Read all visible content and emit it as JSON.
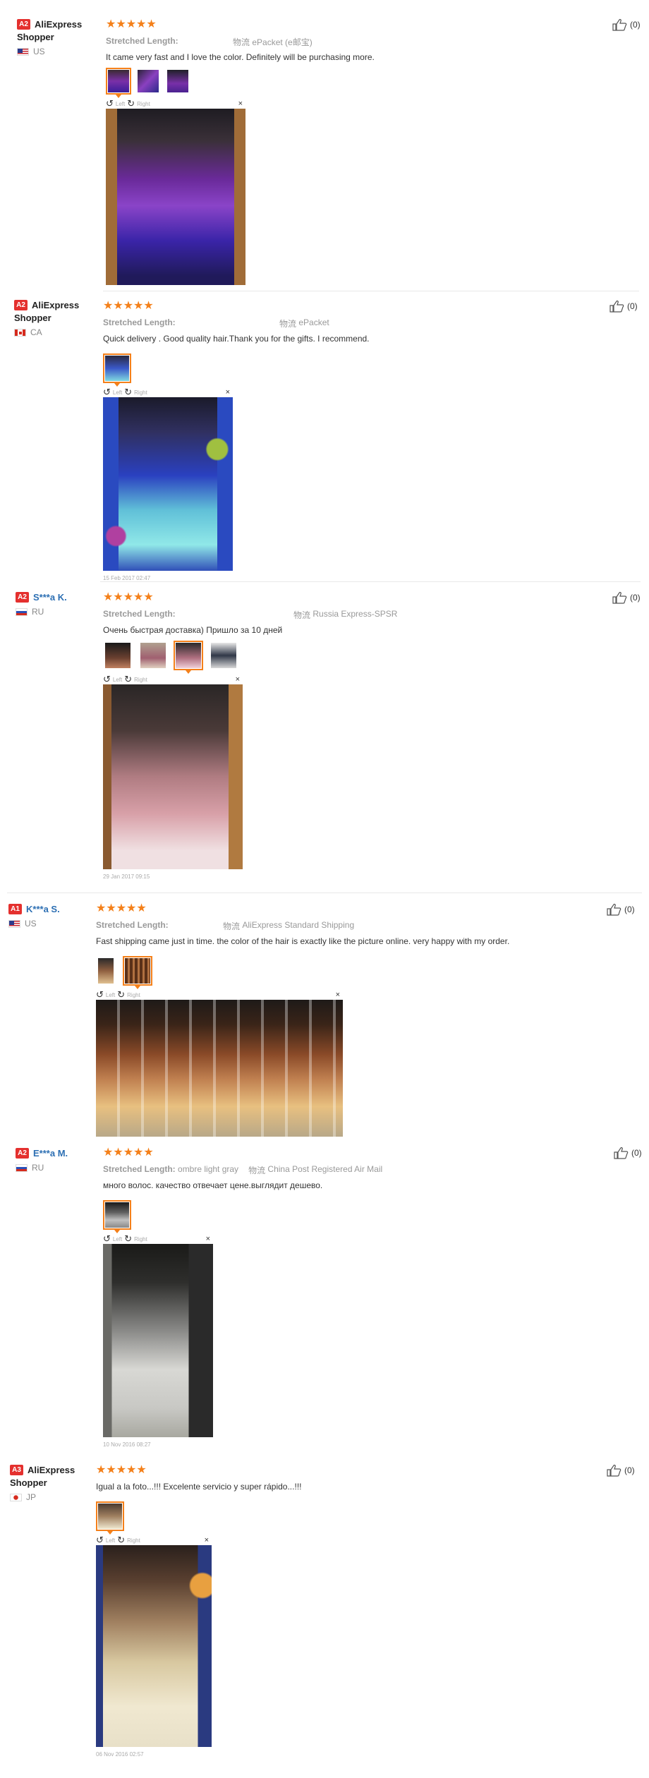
{
  "colors": {
    "star": "#f4801a",
    "badge": "#e4302e",
    "link": "#2c6fb3"
  },
  "stars": "★★★★★",
  "viewer": {
    "left": "Left",
    "right": "Right",
    "rotate_left": "↺",
    "rotate_right": "↻",
    "close": "×"
  },
  "reviews": [
    {
      "level": "A2",
      "name": "AliExpress Shopper",
      "country": "US",
      "attr_key": "Stretched Length:",
      "attr_val": "",
      "ship_icon": "物流",
      "ship": "ePacket (e邮宝)",
      "text": "It came very fast and I love the color. Definitely will be purchasing more.",
      "likes": "(0)",
      "date": "",
      "thumb_count": 3
    },
    {
      "level": "A2",
      "name": "AliExpress Shopper",
      "country": "CA",
      "attr_key": "Stretched Length:",
      "attr_val": "",
      "ship_icon": "物流",
      "ship": "ePacket",
      "text": "Quick delivery . Good quality hair.Thank you for the gifts. I recommend.",
      "likes": "(0)",
      "date": "15 Feb 2017 02:47",
      "thumb_count": 1
    },
    {
      "level": "A2",
      "name": "S***a K.",
      "country": "RU",
      "attr_key": "Stretched Length:",
      "attr_val": "",
      "ship_icon": "物流",
      "ship": "Russia Express-SPSR",
      "text": "Очень быстрая доставка) Пришло за 10 дней",
      "likes": "(0)",
      "date": "29 Jan 2017 09:15",
      "thumb_count": 4
    },
    {
      "level": "A1",
      "name": "K***a S.",
      "country": "US",
      "attr_key": "Stretched Length:",
      "attr_val": "",
      "ship_icon": "物流",
      "ship": "AliExpress Standard Shipping",
      "text": "Fast shipping came just in time. the color of the hair is exactly like the picture online. very happy with my order.",
      "likes": "(0)",
      "date": "",
      "thumb_count": 2
    },
    {
      "level": "A2",
      "name": "E***a M.",
      "country": "RU",
      "attr_key": "Stretched Length:",
      "attr_val": "ombre light gray",
      "ship_icon": "物流",
      "ship": "China Post Registered Air Mail",
      "text": "много волос. качество отвечает цене.выглядит дешево.",
      "likes": "(0)",
      "date": "10 Nov 2016 08:27",
      "thumb_count": 1
    },
    {
      "level": "A3",
      "name": "AliExpress Shopper",
      "country": "JP",
      "attr_key": "",
      "attr_val": "",
      "ship_icon": "",
      "ship": "",
      "text": "Igual a la foto...!!! Excelente servicio y super rápido...!!!",
      "likes": "(0)",
      "date": "06 Nov 2016 02:57",
      "thumb_count": 1
    }
  ]
}
